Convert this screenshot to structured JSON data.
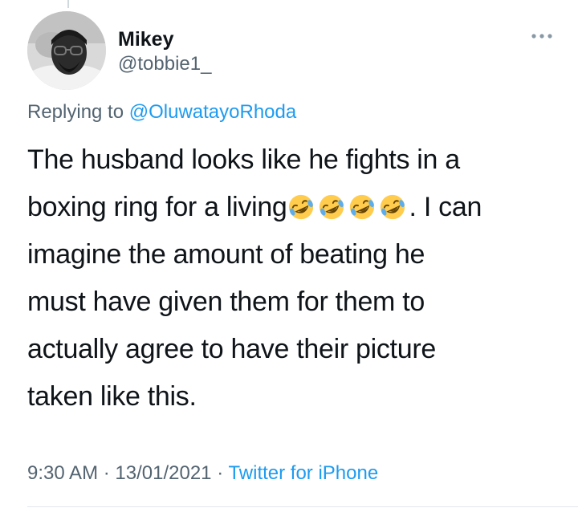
{
  "tweet": {
    "display_name": "Mikey",
    "handle": "@tobbie1_",
    "more_icon": "more-horizontal-icon",
    "reply_prefix": "Replying to ",
    "reply_mention": "@OluwatayoRhoda",
    "text_line1": "The husband looks like he fights in a",
    "text_line2_start": "boxing ring for a living",
    "emoji_name": "rolling-on-floor-laughing-emoji",
    "emoji_count": 4,
    "text_line2_end": ". I can",
    "text_line3": "imagine the amount of beating he",
    "text_line4": "must have given them for them to",
    "text_line5": "actually agree to have their picture",
    "text_line6": "taken like this.",
    "time": "9:30 AM",
    "separator": "·",
    "date": "13/01/2021",
    "source": "Twitter for iPhone"
  },
  "colors": {
    "text_primary": "#0f1419",
    "text_secondary": "#536471",
    "accent_blue": "#1d9bf0"
  }
}
